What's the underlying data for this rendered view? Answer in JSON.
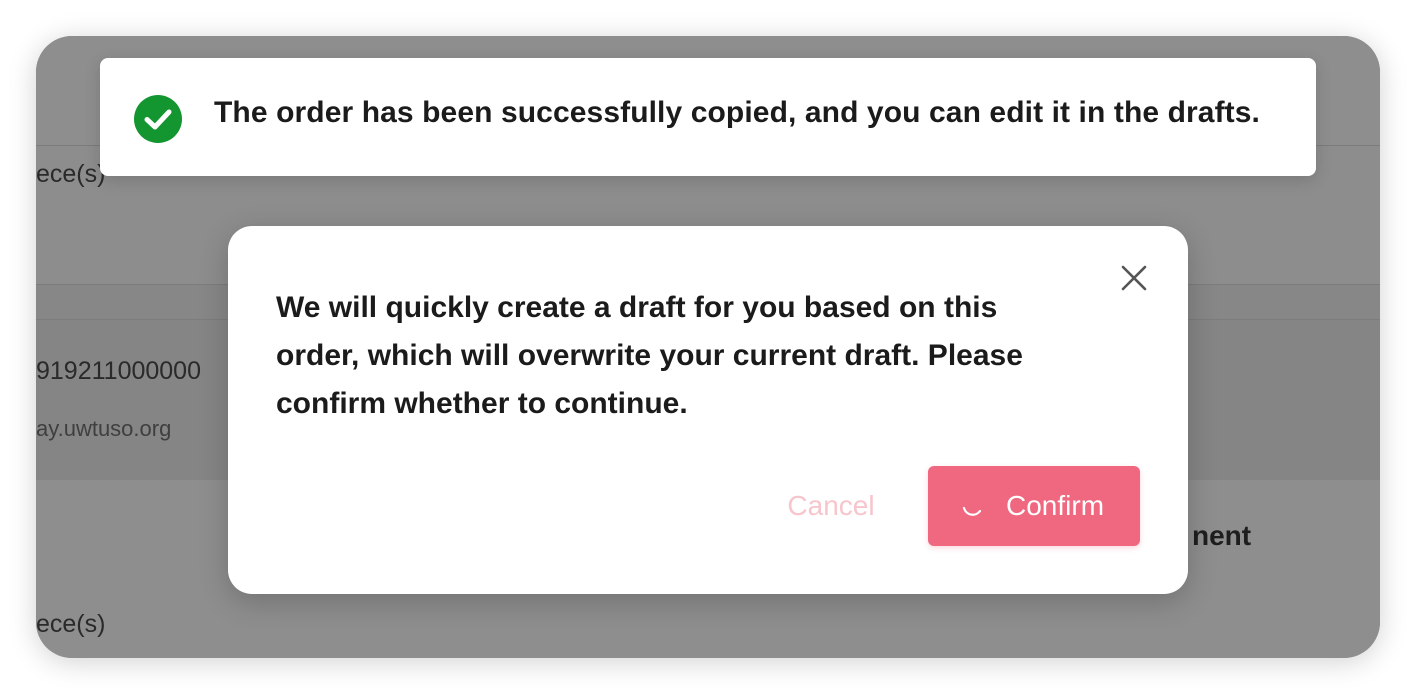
{
  "background": {
    "row1_qty": "ece(s)",
    "row2_order_no": "919211000000",
    "row2_domain": "ay.uwtuso.org",
    "row3_heading_fragment": "nent",
    "row3_qty": "ece(s)"
  },
  "toast": {
    "icon": "check-circle-icon",
    "message": "The order has been successfully copied, and you can edit it in the drafts."
  },
  "modal": {
    "message": "We will quickly create a draft for you based on this order, which will overwrite your current draft. Please confirm whether to continue.",
    "close_icon": "close-icon",
    "cancel_label": "Cancel",
    "confirm_label": "Confirm",
    "confirm_loading": true
  },
  "colors": {
    "success": "#13962f",
    "primary": "#ef6880",
    "cancel_text": "#f7c5cc",
    "overlay": "#8b8b8b"
  }
}
